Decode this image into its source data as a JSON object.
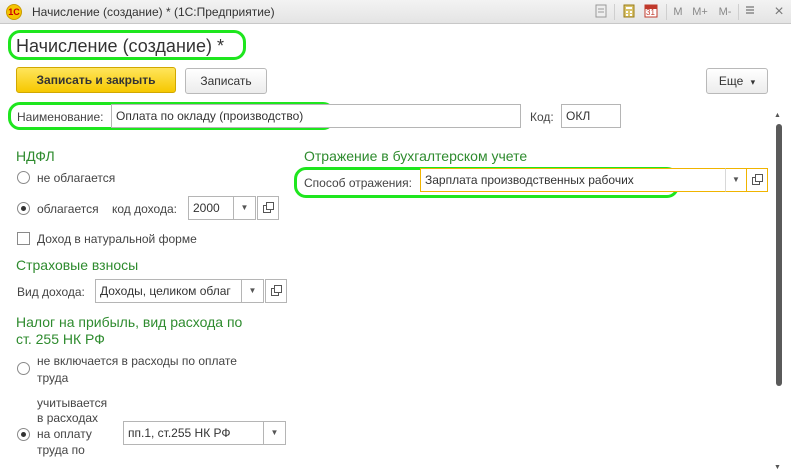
{
  "window": {
    "title": "Начисление (создание) * (1С:Предприятие)",
    "app_icon_text": "1C",
    "toolbar_icons": [
      "bookmark-icon",
      "calculator-icon",
      "calendar-icon",
      "memory-m-icon",
      "memory-m-plus-icon",
      "memory-m-minus-icon",
      "menu-icon",
      "minimize-icon",
      "maximize-icon",
      "close-icon"
    ],
    "calendar_day": "31",
    "m_label": "M",
    "mplus_label": "M+",
    "mminus_label": "M-",
    "close_glyph": "×"
  },
  "page": {
    "title": "Начисление (создание) *"
  },
  "commands": {
    "save_close": "Записать и закрыть",
    "save": "Записать",
    "more": "Еще",
    "more_arrow": "▾"
  },
  "form": {
    "name_label": "Наименование:",
    "name_value": "Оплата по окладу (производство)",
    "code_label": "Код:",
    "code_value": "ОКЛ"
  },
  "ndfl": {
    "title": "НДФЛ",
    "option_not_taxed": "не облагается",
    "option_taxed": "облагается",
    "income_code_label": "код дохода:",
    "income_code_value": "2000",
    "in_kind_label": "Доход в натуральной форме"
  },
  "insurance": {
    "title": "Страховые взносы",
    "income_type_label": "Вид дохода:",
    "income_type_value": "Доходы, целиком облаг"
  },
  "profit_tax": {
    "title_line1": "Налог на прибыль, вид расхода по",
    "title_line2": "ст. 255 НК РФ",
    "option_excluded_line1": "не включается в расходы по оплате",
    "option_excluded_line2": "труда",
    "option_included_line1": "учитывается",
    "option_included_line2": "в расходах",
    "option_included_line3": "на оплату",
    "option_included_line4": "труда по",
    "article_value": "пп.1, ст.255 НК РФ"
  },
  "accounting": {
    "title": "Отражение в бухгалтерском учете",
    "method_label": "Способ отражения:",
    "method_value": "Зарплата производственных рабочих"
  },
  "colors": {
    "highlight": "#1ee61e",
    "section_title": "#2e8b2e",
    "primary_button": "#f6c800",
    "active_field_border": "#f0b400"
  }
}
